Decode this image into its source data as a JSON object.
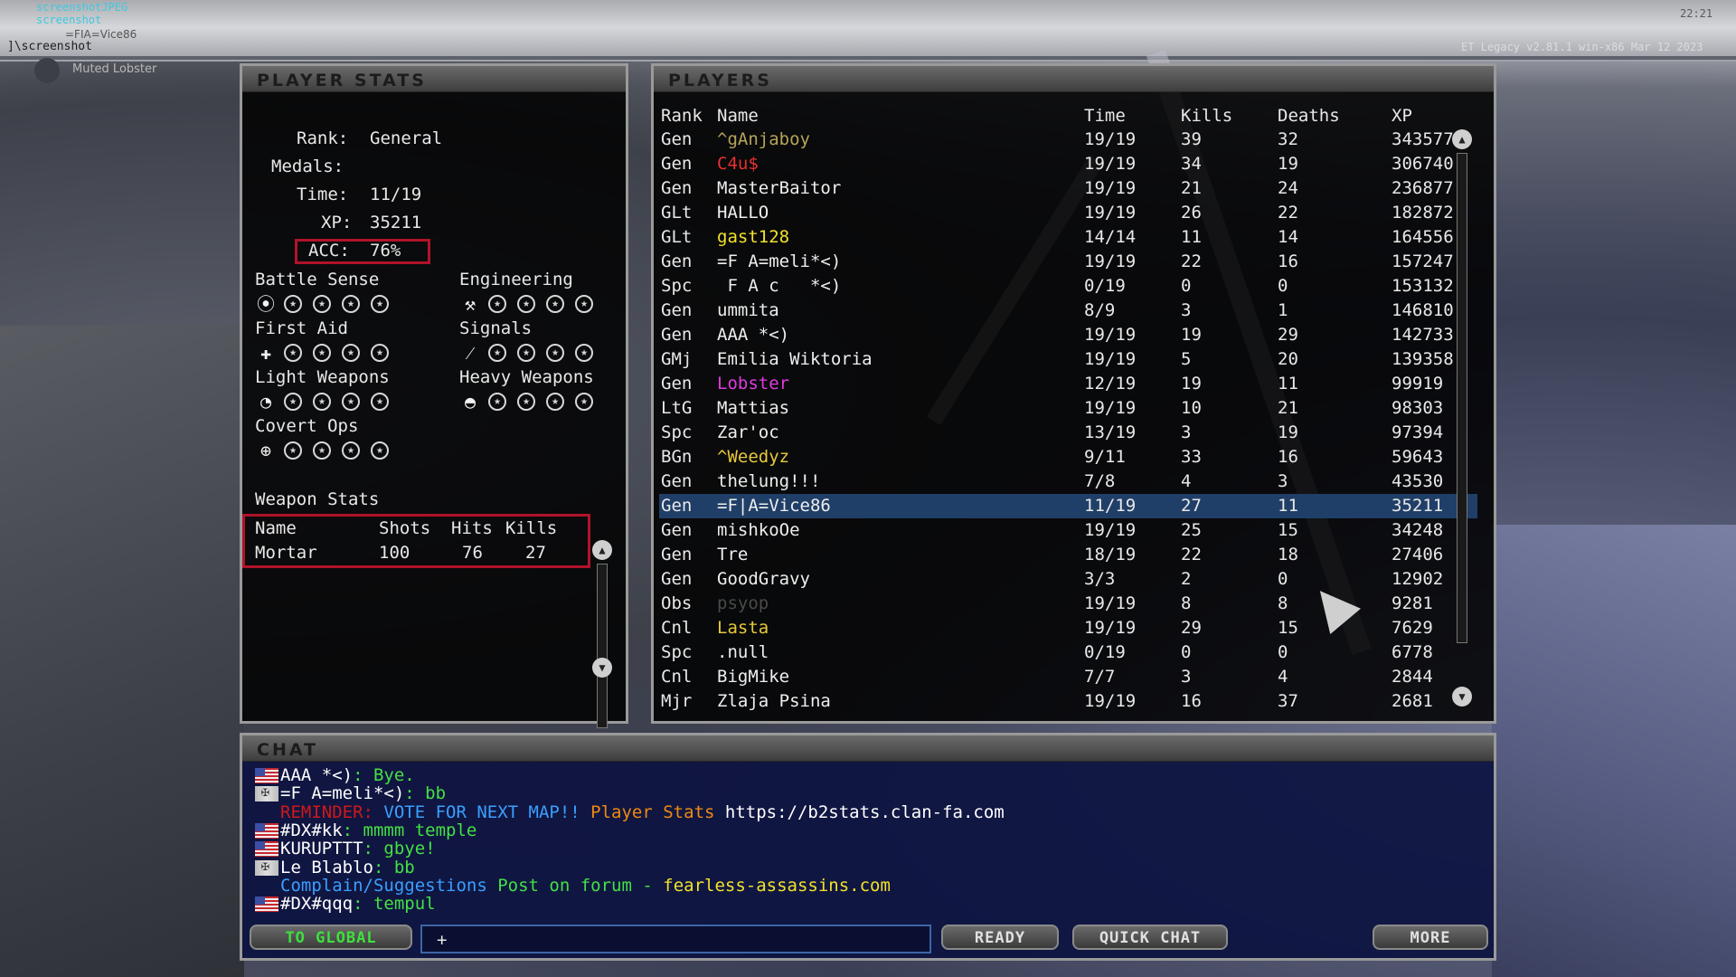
{
  "hud": {
    "screenshot_msg_1": "screenshotJPEG",
    "screenshot_msg_2": "screenshot",
    "console_line": "]\\screenshot",
    "player_tag": "=FIA=Vice86",
    "muted": "Muted Lobster",
    "clock": "22:21",
    "version": "ET Legacy v2.81.1 win-x86 Mar 12 2023"
  },
  "player_stats": {
    "title": "PLAYER STATS",
    "rank_label": "Rank:",
    "rank": "General",
    "medals_label": "Medals:",
    "time_label": "Time:",
    "time": "11/19",
    "xp_label": "XP:",
    "xp": "35211",
    "acc_label": "ACC:",
    "acc": "76%",
    "skills": [
      {
        "label": "Battle Sense",
        "icon": "battle-sense-icon",
        "glyph": "⦿"
      },
      {
        "label": "Engineering",
        "icon": "wrench-icon",
        "glyph": "⚒"
      },
      {
        "label": "First Aid",
        "icon": "medic-cross-icon",
        "glyph": "✚"
      },
      {
        "label": "Signals",
        "icon": "signals-icon",
        "glyph": "⁄"
      },
      {
        "label": "Light Weapons",
        "icon": "light-weapons-icon",
        "glyph": "◔"
      },
      {
        "label": "Heavy Weapons",
        "icon": "heavy-weapons-icon",
        "glyph": "◓"
      },
      {
        "label": "Covert Ops",
        "icon": "crosshair-icon",
        "glyph": "⊕"
      }
    ],
    "weapon_stats_title": "Weapon Stats",
    "weapon_headers": {
      "name": "Name",
      "shots": "Shots",
      "hits": "Hits",
      "kills": "Kills"
    },
    "weapons": [
      {
        "name": "Mortar",
        "shots": "100",
        "hits": "76",
        "kills": "27"
      }
    ]
  },
  "players": {
    "title": "PLAYERS",
    "headers": {
      "rank": "Rank",
      "name": "Name",
      "time": "Time",
      "kills": "Kills",
      "deaths": "Deaths",
      "xp": "XP"
    },
    "rows": [
      {
        "rank": "Gen",
        "name": "^gAnjaboy",
        "time": "19/19",
        "kills": "39",
        "deaths": "32",
        "xp": "343577",
        "color": "#b5a45a"
      },
      {
        "rank": "Gen",
        "name": "C4u$",
        "time": "19/19",
        "kills": "34",
        "deaths": "19",
        "xp": "306740",
        "color": "#e83030"
      },
      {
        "rank": "Gen",
        "name": "MasterBaitor",
        "time": "19/19",
        "kills": "21",
        "deaths": "24",
        "xp": "236877",
        "color": "#eeeeee"
      },
      {
        "rank": "GLt",
        "name": "HALLO",
        "time": "19/19",
        "kills": "26",
        "deaths": "22",
        "xp": "182872",
        "color": "#eeeeee"
      },
      {
        "rank": "GLt",
        "name": "gast128",
        "time": "14/14",
        "kills": "11",
        "deaths": "14",
        "xp": "164556",
        "color": "#f2e22a"
      },
      {
        "rank": "Gen",
        "name": "=F A=meli*<)",
        "time": "19/19",
        "kills": "22",
        "deaths": "16",
        "xp": "157247",
        "color": "#eeeeee"
      },
      {
        "rank": "Spc",
        "name": " F A c   *<)",
        "time": "0/19",
        "kills": "0",
        "deaths": "0",
        "xp": "153132",
        "color": "#eeeeee"
      },
      {
        "rank": "Gen",
        "name": "ummita",
        "time": "8/9",
        "kills": "3",
        "deaths": "1",
        "xp": "146810",
        "color": "#eeeeee"
      },
      {
        "rank": "Gen",
        "name": "AAA *<)",
        "time": "19/19",
        "kills": "19",
        "deaths": "29",
        "xp": "142733",
        "color": "#eeeeee"
      },
      {
        "rank": "GMj",
        "name": "Emilia Wiktoria",
        "time": "19/19",
        "kills": "5",
        "deaths": "20",
        "xp": "139358",
        "color": "#eeeeee"
      },
      {
        "rank": "Gen",
        "name": "Lobster",
        "time": "12/19",
        "kills": "19",
        "deaths": "11",
        "xp": "99919",
        "color": "#e03ae0"
      },
      {
        "rank": "LtG",
        "name": "Mattias",
        "time": "19/19",
        "kills": "10",
        "deaths": "21",
        "xp": "98303",
        "color": "#eeeeee"
      },
      {
        "rank": "Spc",
        "name": "Zar'oc",
        "time": "13/19",
        "kills": "3",
        "deaths": "19",
        "xp": "97394",
        "color": "#eeeeee"
      },
      {
        "rank": "BGn",
        "name": "^Weedyz",
        "time": "9/11",
        "kills": "33",
        "deaths": "16",
        "xp": "59643",
        "color": "#e8c83a"
      },
      {
        "rank": "Gen",
        "name": "thelung!!!",
        "time": "7/8",
        "kills": "4",
        "deaths": "3",
        "xp": "43530",
        "color": "#eeeeee"
      },
      {
        "rank": "Gen",
        "name": "=F|A=Vice86",
        "time": "11/19",
        "kills": "27",
        "deaths": "11",
        "xp": "35211",
        "color": "#eeeeee"
      },
      {
        "rank": "Gen",
        "name": "mishkoOe",
        "time": "19/19",
        "kills": "25",
        "deaths": "15",
        "xp": "34248",
        "color": "#eeeeee"
      },
      {
        "rank": "Gen",
        "name": "Tre",
        "time": "18/19",
        "kills": "22",
        "deaths": "18",
        "xp": "27406",
        "color": "#eeeeee"
      },
      {
        "rank": "Gen",
        "name": "GoodGravy",
        "time": "3/3",
        "kills": "2",
        "deaths": "0",
        "xp": "12902",
        "color": "#eeeeee"
      },
      {
        "rank": "Obs",
        "name": "psyop",
        "time": "19/19",
        "kills": "8",
        "deaths": "8",
        "xp": "9281",
        "color": "#4a4a4a"
      },
      {
        "rank": "Cnl",
        "name": "Lasta",
        "time": "19/19",
        "kills": "29",
        "deaths": "15",
        "xp": "7629",
        "color": "#e8c83a"
      },
      {
        "rank": "Spc",
        "name": ".null",
        "time": "0/19",
        "kills": "0",
        "deaths": "0",
        "xp": "6778",
        "color": "#eeeeee"
      },
      {
        "rank": "Cnl",
        "name": "BigMike",
        "time": "7/7",
        "kills": "3",
        "deaths": "4",
        "xp": "2844",
        "color": "#eeeeee"
      },
      {
        "rank": "Mjr",
        "name": "Zlaja Psina",
        "time": "19/19",
        "kills": "16",
        "deaths": "37",
        "xp": "2681",
        "color": "#eeeeee"
      }
    ]
  },
  "chat": {
    "title": "CHAT",
    "lines": [
      {
        "flag": "us",
        "name": "AAA *<)",
        "name_color": "#ffffff",
        "msg": ": Bye.",
        "msg_color": "#44e044"
      },
      {
        "flag": "de",
        "name": "=F A=meli*<)",
        "name_color": "#ffffff",
        "msg": ": bb",
        "msg_color": "#44e044"
      },
      {
        "flag": "",
        "name": "REMINDER:",
        "name_color": "#d01818",
        "msg": " VOTE FOR NEXT MAP!!",
        "msg_color": "#3aa0ff",
        "extra": " Player Stats",
        "extra_color": "#f08a10",
        "extra2": " https://b2stats.clan-fa.com",
        "extra2_color": "#ffffff"
      },
      {
        "flag": "us",
        "name": "#DX#kk",
        "name_color": "#ffffff",
        "msg": ": mmmm temple",
        "msg_color": "#44e044"
      },
      {
        "flag": "us",
        "name": "KURUPTTT",
        "name_color": "#ffffff",
        "msg": ": gbye!",
        "msg_color": "#44e044"
      },
      {
        "flag": "de",
        "name": "Le Blablo",
        "name_color": "#ffffff",
        "msg": ": bb",
        "msg_color": "#44e044"
      },
      {
        "flag": "",
        "name": "Complain/Suggestions",
        "name_color": "#3aa0ff",
        "msg": " Post on forum - ",
        "msg_color": "#44e044",
        "extra": "fearless-assassins.com",
        "extra_color": "#f2e22a"
      },
      {
        "flag": "us",
        "name": "#DX#qqq",
        "name_color": "#ffffff",
        "msg": ": tempul",
        "msg_color": "#44e044"
      }
    ],
    "to_global": "TO GLOBAL",
    "input_prompt": "+",
    "ready": "READY",
    "quick_chat": "QUICK CHAT",
    "more": "MORE"
  }
}
